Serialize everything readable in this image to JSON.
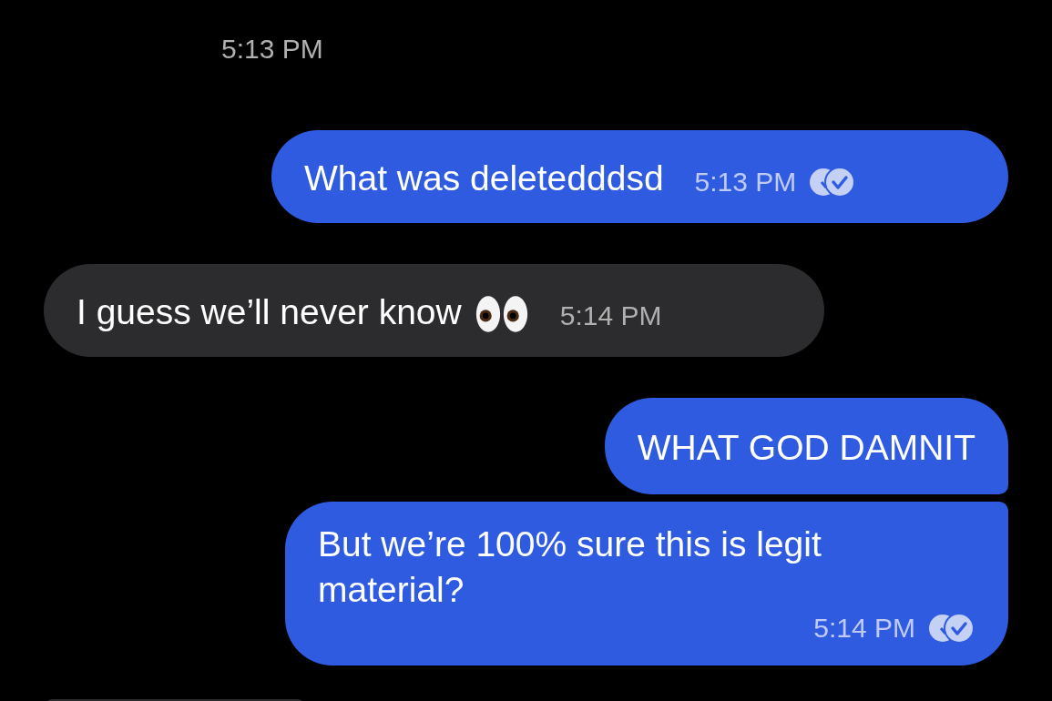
{
  "timestamp": "5:13 PM",
  "messages": [
    {
      "kind": "outgoing",
      "text": "What was deletedddsd",
      "time": "5:13 PM",
      "read": true
    },
    {
      "kind": "incoming-emoji",
      "text": "I guess we’ll never know",
      "time": "5:14 PM"
    },
    {
      "kind": "outgoing",
      "text": "WHAT GOD DAMNIT"
    },
    {
      "kind": "outgoing",
      "text": "But we’re 100% sure this is legit material?",
      "time": "5:14 PM",
      "read": true
    },
    {
      "kind": "incoming"
    }
  ]
}
